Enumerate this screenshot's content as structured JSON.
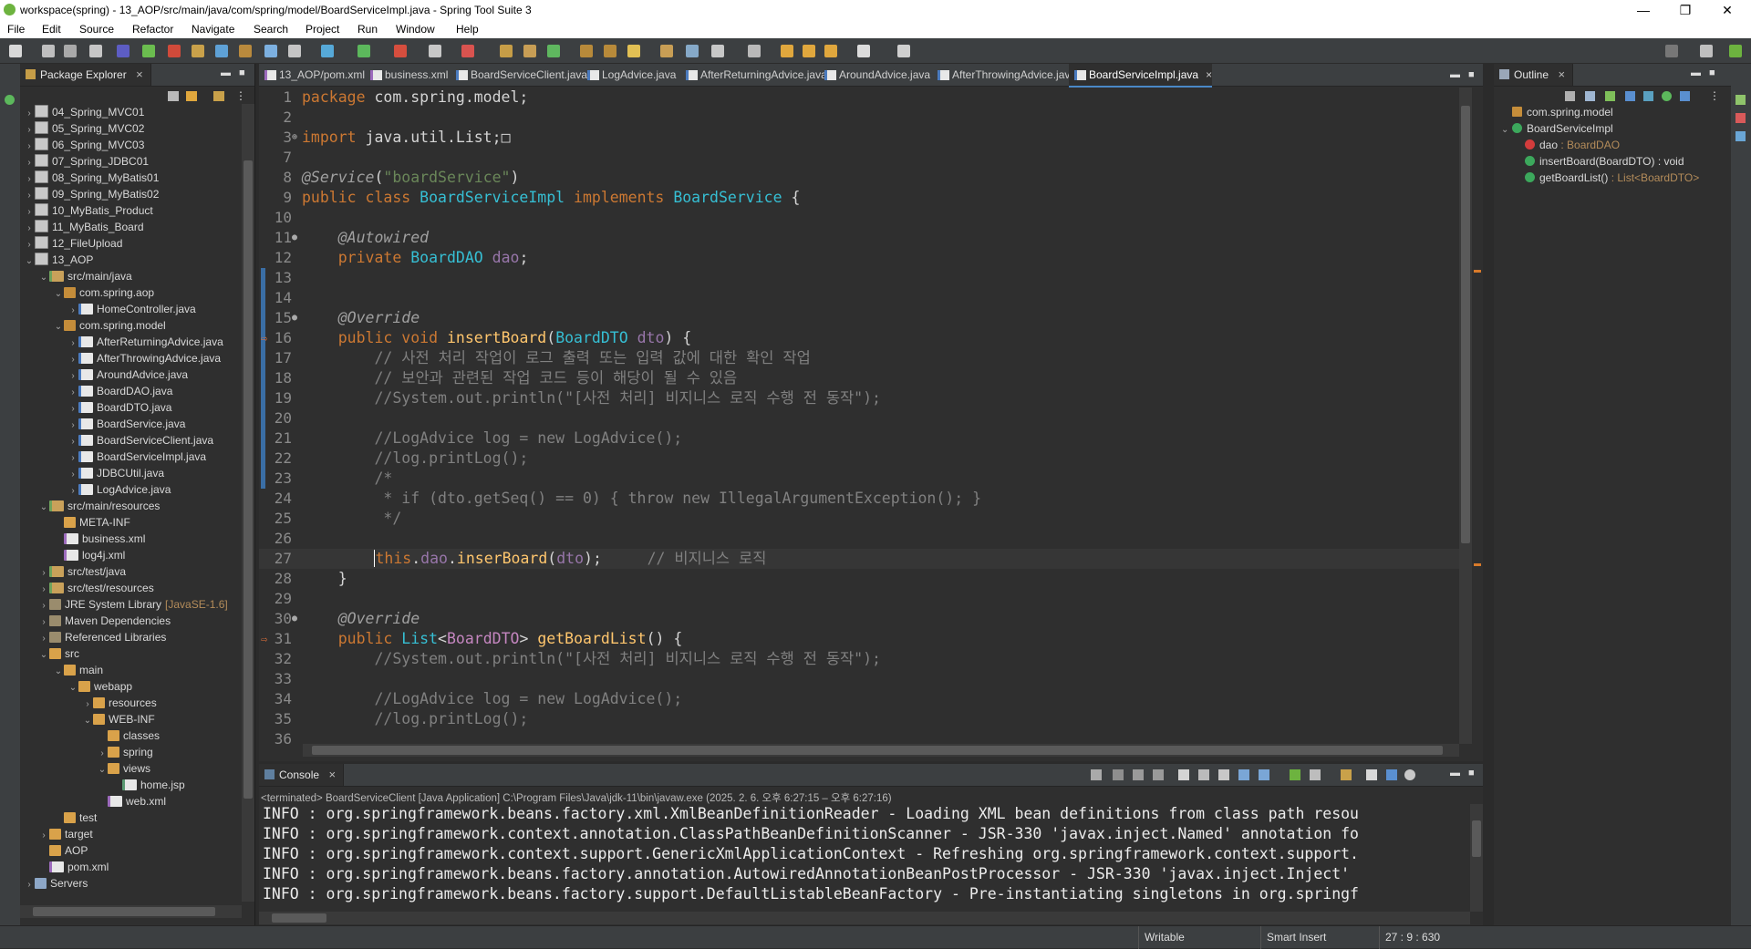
{
  "window": {
    "title": "workspace(spring) - 13_AOP/src/main/java/com/spring/model/BoardServiceImpl.java - Spring Tool Suite 3",
    "minimize": "—",
    "restore": "❐",
    "close": "✕"
  },
  "menu": [
    "File",
    "Edit",
    "Source",
    "Refactor",
    "Navigate",
    "Search",
    "Project",
    "Run",
    "Window",
    "Help"
  ],
  "package_explorer": {
    "title": "Package Explorer",
    "items": [
      {
        "label": "04_Spring_MVC01",
        "depth": 0,
        "twisty": "›",
        "icon": "proj"
      },
      {
        "label": "05_Spring_MVC02",
        "depth": 0,
        "twisty": "›",
        "icon": "proj"
      },
      {
        "label": "06_Spring_MVC03",
        "depth": 0,
        "twisty": "›",
        "icon": "proj"
      },
      {
        "label": "07_Spring_JDBC01",
        "depth": 0,
        "twisty": "›",
        "icon": "proj"
      },
      {
        "label": "08_Spring_MyBatis01",
        "depth": 0,
        "twisty": "›",
        "icon": "proj"
      },
      {
        "label": "09_Spring_MyBatis02",
        "depth": 0,
        "twisty": "›",
        "icon": "proj"
      },
      {
        "label": "10_MyBatis_Product",
        "depth": 0,
        "twisty": "›",
        "icon": "proj"
      },
      {
        "label": "11_MyBatis_Board",
        "depth": 0,
        "twisty": "›",
        "icon": "proj"
      },
      {
        "label": "12_FileUpload",
        "depth": 0,
        "twisty": "›",
        "icon": "proj"
      },
      {
        "label": "13_AOP",
        "depth": 0,
        "twisty": "⌄",
        "icon": "proj"
      },
      {
        "label": "src/main/java",
        "depth": 1,
        "twisty": "⌄",
        "icon": "srcf"
      },
      {
        "label": "com.spring.aop",
        "depth": 2,
        "twisty": "⌄",
        "icon": "pkg"
      },
      {
        "label": "HomeController.java",
        "depth": 3,
        "twisty": "›",
        "icon": "java"
      },
      {
        "label": "com.spring.model",
        "depth": 2,
        "twisty": "⌄",
        "icon": "pkg"
      },
      {
        "label": "AfterReturningAdvice.java",
        "depth": 3,
        "twisty": "›",
        "icon": "java"
      },
      {
        "label": "AfterThrowingAdvice.java",
        "depth": 3,
        "twisty": "›",
        "icon": "java"
      },
      {
        "label": "AroundAdvice.java",
        "depth": 3,
        "twisty": "›",
        "icon": "java"
      },
      {
        "label": "BoardDAO.java",
        "depth": 3,
        "twisty": "›",
        "icon": "java"
      },
      {
        "label": "BoardDTO.java",
        "depth": 3,
        "twisty": "›",
        "icon": "java"
      },
      {
        "label": "BoardService.java",
        "depth": 3,
        "twisty": "›",
        "icon": "java"
      },
      {
        "label": "BoardServiceClient.java",
        "depth": 3,
        "twisty": "›",
        "icon": "java"
      },
      {
        "label": "BoardServiceImpl.java",
        "depth": 3,
        "twisty": "›",
        "icon": "java"
      },
      {
        "label": "JDBCUtil.java",
        "depth": 3,
        "twisty": "›",
        "icon": "java"
      },
      {
        "label": "LogAdvice.java",
        "depth": 3,
        "twisty": "›",
        "icon": "java"
      },
      {
        "label": "src/main/resources",
        "depth": 1,
        "twisty": "⌄",
        "icon": "srcf"
      },
      {
        "label": "META-INF",
        "depth": 2,
        "twisty": "",
        "icon": "folder"
      },
      {
        "label": "business.xml",
        "depth": 2,
        "twisty": "",
        "icon": "xml"
      },
      {
        "label": "log4j.xml",
        "depth": 2,
        "twisty": "",
        "icon": "xml"
      },
      {
        "label": "src/test/java",
        "depth": 1,
        "twisty": "›",
        "icon": "srcf"
      },
      {
        "label": "src/test/resources",
        "depth": 1,
        "twisty": "›",
        "icon": "srcf"
      },
      {
        "label": "JRE System Library",
        "suffix": "[JavaSE-1.6]",
        "depth": 1,
        "twisty": "›",
        "icon": "lib"
      },
      {
        "label": "Maven Dependencies",
        "depth": 1,
        "twisty": "›",
        "icon": "lib"
      },
      {
        "label": "Referenced Libraries",
        "depth": 1,
        "twisty": "›",
        "icon": "lib"
      },
      {
        "label": "src",
        "depth": 1,
        "twisty": "⌄",
        "icon": "folder"
      },
      {
        "label": "main",
        "depth": 2,
        "twisty": "⌄",
        "icon": "folder"
      },
      {
        "label": "webapp",
        "depth": 3,
        "twisty": "⌄",
        "icon": "folder"
      },
      {
        "label": "resources",
        "depth": 4,
        "twisty": "›",
        "icon": "folder"
      },
      {
        "label": "WEB-INF",
        "depth": 4,
        "twisty": "⌄",
        "icon": "folder"
      },
      {
        "label": "classes",
        "depth": 5,
        "twisty": "",
        "icon": "folder"
      },
      {
        "label": "spring",
        "depth": 5,
        "twisty": "›",
        "icon": "folder"
      },
      {
        "label": "views",
        "depth": 5,
        "twisty": "⌄",
        "icon": "folder"
      },
      {
        "label": "home.jsp",
        "depth": 6,
        "twisty": "",
        "icon": "jsp"
      },
      {
        "label": "web.xml",
        "depth": 5,
        "twisty": "",
        "icon": "xml"
      },
      {
        "label": "test",
        "depth": 2,
        "twisty": "",
        "icon": "folder"
      },
      {
        "label": "target",
        "depth": 1,
        "twisty": "›",
        "icon": "folder"
      },
      {
        "label": "AOP",
        "depth": 1,
        "twisty": "",
        "icon": "folder"
      },
      {
        "label": "pom.xml",
        "depth": 1,
        "twisty": "",
        "icon": "xml"
      },
      {
        "label": "Servers",
        "depth": 0,
        "twisty": "›",
        "icon": "srv"
      }
    ]
  },
  "editor": {
    "tabs": [
      {
        "label": "13_AOP/pom.xml",
        "kind": "xml"
      },
      {
        "label": "business.xml",
        "kind": "xml"
      },
      {
        "label": "BoardServiceClient.java",
        "kind": "java"
      },
      {
        "label": "LogAdvice.java",
        "kind": "java"
      },
      {
        "label": "AfterReturningAdvice.java",
        "kind": "java"
      },
      {
        "label": "AroundAdvice.java",
        "kind": "java"
      },
      {
        "label": "AfterThrowingAdvice.java",
        "kind": "java"
      },
      {
        "label": "BoardServiceImpl.java",
        "kind": "java",
        "active": true
      }
    ],
    "lines": [
      {
        "n": "1",
        "parts": [
          [
            "kw",
            "package"
          ],
          [
            "pl",
            " com.spring.model;"
          ]
        ]
      },
      {
        "n": "2",
        "parts": []
      },
      {
        "n": "3",
        "fold": "⊕",
        "parts": [
          [
            "kw",
            "import"
          ],
          [
            "pl",
            " java.util.List;"
          ],
          [
            "pl",
            "□"
          ]
        ]
      },
      {
        "n": "7",
        "parts": []
      },
      {
        "n": "8",
        "parts": [
          [
            "an",
            "@Service"
          ],
          [
            "pl",
            "("
          ],
          [
            "st",
            "\"boardService\""
          ],
          [
            "pl",
            ")"
          ]
        ]
      },
      {
        "n": "9",
        "parts": [
          [
            "kw",
            "public class "
          ],
          [
            "ty",
            "BoardServiceImpl"
          ],
          [
            "kw",
            " implements "
          ],
          [
            "ty",
            "BoardService"
          ],
          [
            "pl",
            " {"
          ]
        ]
      },
      {
        "n": "10",
        "parts": []
      },
      {
        "n": "11",
        "fold": "●",
        "parts": [
          [
            "pl",
            "    "
          ],
          [
            "an",
            "@Autowired"
          ]
        ]
      },
      {
        "n": "12",
        "parts": [
          [
            "pl",
            "    "
          ],
          [
            "kw",
            "private "
          ],
          [
            "ty",
            "BoardDAO"
          ],
          [
            "pl",
            " "
          ],
          [
            "vr",
            "dao"
          ],
          [
            "pl",
            ";"
          ]
        ]
      },
      {
        "n": "13",
        "parts": []
      },
      {
        "n": "14",
        "parts": []
      },
      {
        "n": "15",
        "fold": "●",
        "parts": [
          [
            "pl",
            "    "
          ],
          [
            "an",
            "@Override"
          ]
        ]
      },
      {
        "n": "16",
        "marker": "⇨",
        "parts": [
          [
            "pl",
            "    "
          ],
          [
            "kw",
            "public void "
          ],
          [
            "fn",
            "insertBoard"
          ],
          [
            "pl",
            "("
          ],
          [
            "ty",
            "BoardDTO"
          ],
          [
            "pl",
            " "
          ],
          [
            "vr",
            "dto"
          ],
          [
            "pl",
            ") {"
          ]
        ]
      },
      {
        "n": "17",
        "parts": [
          [
            "cm",
            "        // 사전 처리 작업이 로그 출력 또는 입력 값에 대한 확인 작업"
          ]
        ]
      },
      {
        "n": "18",
        "parts": [
          [
            "cm",
            "        // 보안과 관련된 작업 코드 등이 해당이 될 수 있음"
          ]
        ]
      },
      {
        "n": "19",
        "parts": [
          [
            "cm",
            "        //System.out.println(\"[사전 처리] 비지니스 로직 수행 전 동작\");"
          ]
        ]
      },
      {
        "n": "20",
        "parts": []
      },
      {
        "n": "21",
        "parts": [
          [
            "cm",
            "        //LogAdvice log = new LogAdvice();"
          ]
        ]
      },
      {
        "n": "22",
        "parts": [
          [
            "cm",
            "        //log.printLog();"
          ]
        ]
      },
      {
        "n": "23",
        "parts": [
          [
            "cm",
            "        /*"
          ]
        ]
      },
      {
        "n": "24",
        "parts": [
          [
            "cm",
            "         * if (dto.getSeq() == 0) { throw new IllegalArgumentException(); }"
          ]
        ]
      },
      {
        "n": "25",
        "parts": [
          [
            "cm",
            "         */"
          ]
        ]
      },
      {
        "n": "26",
        "parts": []
      },
      {
        "n": "27",
        "current": true,
        "parts": [
          [
            "pl",
            "        "
          ],
          [
            "kw",
            "this"
          ],
          [
            "pl",
            "."
          ],
          [
            "vr",
            "dao"
          ],
          [
            "pl",
            "."
          ],
          [
            "fn",
            "inserBoard"
          ],
          [
            "pl",
            "("
          ],
          [
            "vr",
            "dto"
          ],
          [
            "pl",
            ");     "
          ],
          [
            "cm",
            "// 비지니스 로직"
          ]
        ]
      },
      {
        "n": "28",
        "parts": [
          [
            "pl",
            "    }"
          ]
        ]
      },
      {
        "n": "29",
        "parts": []
      },
      {
        "n": "30",
        "fold": "●",
        "parts": [
          [
            "pl",
            "    "
          ],
          [
            "an",
            "@Override"
          ]
        ]
      },
      {
        "n": "31",
        "marker": "⇨",
        "parts": [
          [
            "pl",
            "    "
          ],
          [
            "kw",
            "public "
          ],
          [
            "ty",
            "List"
          ],
          [
            "pl",
            "<"
          ],
          [
            "tg",
            "BoardDTO"
          ],
          [
            "pl",
            "> "
          ],
          [
            "fn",
            "getBoardList"
          ],
          [
            "pl",
            "() {"
          ]
        ]
      },
      {
        "n": "32",
        "parts": [
          [
            "cm",
            "        //System.out.println(\"[사전 처리] 비지니스 로직 수행 전 동작\");"
          ]
        ]
      },
      {
        "n": "33",
        "parts": []
      },
      {
        "n": "34",
        "parts": [
          [
            "cm",
            "        //LogAdvice log = new LogAdvice();"
          ]
        ]
      },
      {
        "n": "35",
        "parts": [
          [
            "cm",
            "        //log.printLog();"
          ]
        ]
      },
      {
        "n": "36",
        "parts": []
      }
    ]
  },
  "outline": {
    "title": "Outline",
    "items": [
      {
        "label": "com.spring.model",
        "depth": 0,
        "twisty": "",
        "color": "#c58d3a",
        "square": true
      },
      {
        "label": "BoardServiceImpl",
        "depth": 0,
        "twisty": "⌄",
        "color": "#3ca85c"
      },
      {
        "label": "dao",
        "type": " : BoardDAO",
        "depth": 1,
        "twisty": "",
        "color": "#d33c3c"
      },
      {
        "label": "insertBoard(BoardDTO) : void",
        "type": "",
        "depth": 1,
        "twisty": "",
        "color": "#3ca85c"
      },
      {
        "label": "getBoardList()",
        "type": " : List<BoardDTO>",
        "depth": 1,
        "twisty": "",
        "color": "#3ca85c"
      }
    ]
  },
  "console": {
    "title": "Console",
    "info": "<terminated> BoardServiceClient [Java Application] C:\\Program Files\\Java\\jdk-11\\bin\\javaw.exe  (2025. 2. 6. 오후 6:27:15 – 오후 6:27:16)",
    "lines": [
      "INFO : org.springframework.beans.factory.xml.XmlBeanDefinitionReader - Loading XML bean definitions from class path resou",
      "INFO : org.springframework.context.annotation.ClassPathBeanDefinitionScanner - JSR-330 'javax.inject.Named' annotation fo",
      "INFO : org.springframework.context.support.GenericXmlApplicationContext - Refreshing org.springframework.context.support.",
      "INFO : org.springframework.beans.factory.annotation.AutowiredAnnotationBeanPostProcessor - JSR-330 'javax.inject.Inject'",
      "INFO : org.springframework.beans.factory.support.DefaultListableBeanFactory - Pre-instantiating singletons in org.springf"
    ]
  },
  "status": {
    "writable": "Writable",
    "insert_mode": "Smart Insert",
    "position": "27 : 9 : 630"
  }
}
